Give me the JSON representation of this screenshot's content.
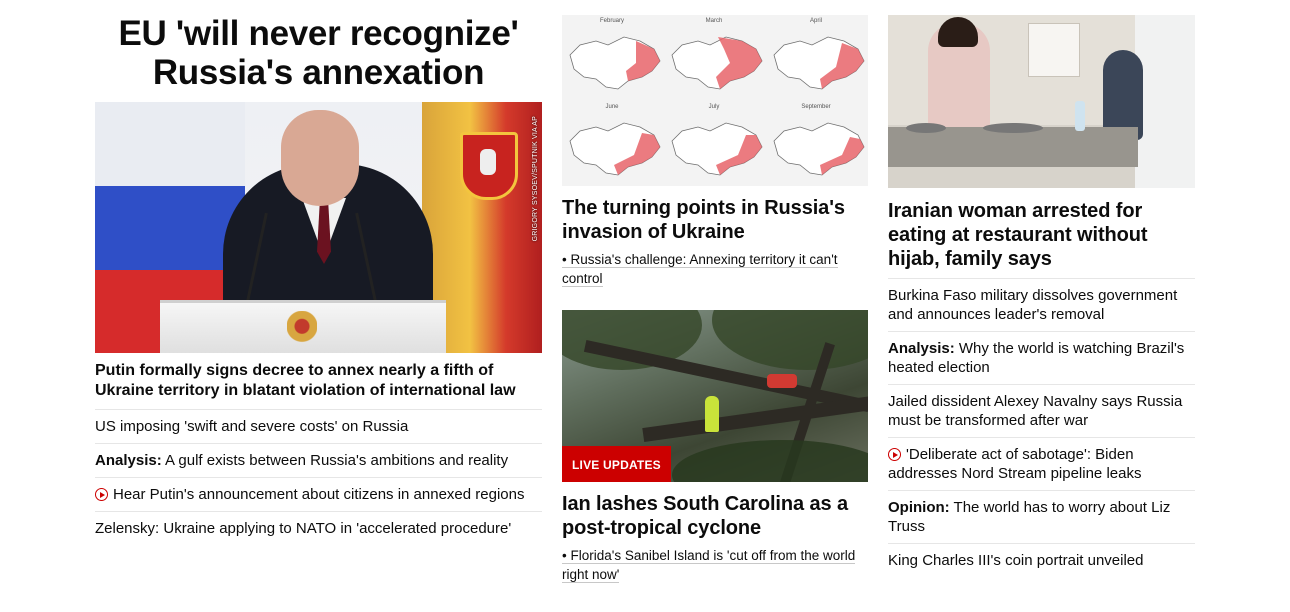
{
  "column1": {
    "title": "EU 'will never recognize' Russia's annexation",
    "image_credit": "GRIGORY SYSOEV/SPUTNIK VIA AP",
    "lead_headline": "Putin formally signs decree to annex nearly a fifth of Ukraine territory in blatant violation of international law",
    "links": [
      {
        "prefix": "",
        "text": "US imposing 'swift and severe costs' on Russia",
        "video": false
      },
      {
        "prefix": "Analysis:",
        "text": " A gulf exists between Russia's ambitions and reality",
        "video": false
      },
      {
        "prefix": "",
        "text": "Hear Putin's announcement about citizens in annexed regions",
        "video": true
      },
      {
        "prefix": "",
        "text": "Zelensky: Ukraine applying to NATO in 'accelerated procedure'",
        "video": false
      }
    ]
  },
  "column2": {
    "map_months": [
      "February",
      "March",
      "April",
      "June",
      "July",
      "September"
    ],
    "card1": {
      "headline": "The turning points in Russia's invasion of Ukraine",
      "bullet": "• Russia's challenge: Annexing territory it can't control"
    },
    "card2": {
      "badge": "LIVE UPDATES",
      "headline": "Ian lashes South Carolina as a post-tropical cyclone",
      "bullet": "• Florida's Sanibel Island is 'cut off from the world right now'"
    }
  },
  "column3": {
    "headline": "Iranian woman arrested for eating at restaurant without hijab, family says",
    "links": [
      {
        "prefix": "",
        "text": "Burkina Faso military dissolves government and announces leader's removal",
        "video": false
      },
      {
        "prefix": "Analysis:",
        "text": " Why the world is watching Brazil's heated election",
        "video": false
      },
      {
        "prefix": "",
        "text": "Jailed dissident Alexey Navalny says Russia must be transformed after war",
        "video": false
      },
      {
        "prefix": "",
        "text": "'Deliberate act of sabotage': Biden addresses Nord Stream pipeline leaks",
        "video": true
      },
      {
        "prefix": "Opinion:",
        "text": " The world has to worry about Liz Truss",
        "video": false
      },
      {
        "prefix": "",
        "text": "King Charles III's coin portrait unveiled",
        "video": false
      }
    ]
  },
  "colors": {
    "accent_red": "#cc0000",
    "text": "#0c0c0c",
    "divider": "#e6e6e6",
    "map_occupied": "#e8646a"
  }
}
